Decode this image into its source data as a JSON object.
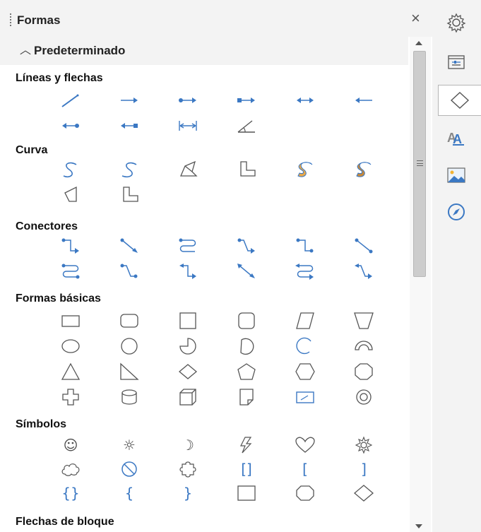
{
  "panel": {
    "title": "Formas",
    "close_glyph": "×",
    "deck": {
      "chevron": "︿",
      "title": "Predeterminado"
    }
  },
  "sections": {
    "lines": "Líneas y flechas",
    "curve": "Curva",
    "connectors": "Conectores",
    "basic": "Formas básicas",
    "symbols": "Símbolos",
    "block_arrows": "Flechas de bloque"
  },
  "symbol_glyphs": {
    "smiley": "☺",
    "sun": "☼",
    "moon": "☽",
    "brackets_double": "[]",
    "bracket_left": "[",
    "bracket_right": "]",
    "braces_double": "{}",
    "brace_left": "{",
    "brace_right": "}"
  },
  "tabs": [
    "properties-gear-icon",
    "page-properties-icon",
    "shapes-icon",
    "styles-icon",
    "gallery-icon",
    "navigator-icon"
  ],
  "colors": {
    "accent": "#3b78c3",
    "shape_stroke": "#555555",
    "text": "#222222",
    "panel_bg": "#f3f3f3"
  }
}
